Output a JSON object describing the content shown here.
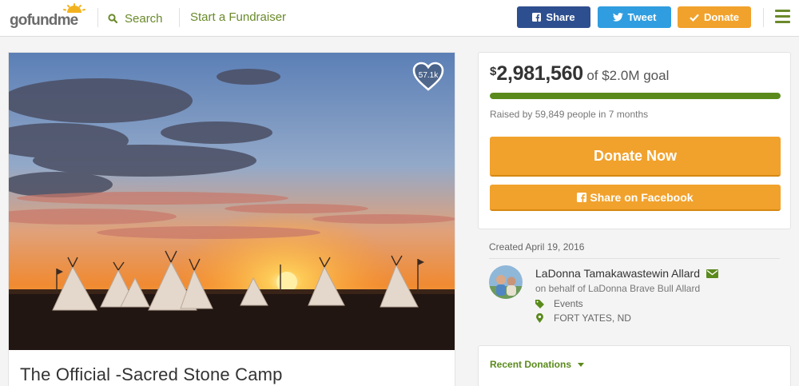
{
  "header": {
    "logo": {
      "text_go": "go",
      "text_fund": "fund",
      "text_me": "me",
      "icon": "sun-logo-icon"
    },
    "search_label": "Search",
    "start_label": "Start a Fundraiser",
    "share_label": "Share",
    "tweet_label": "Tweet",
    "donate_label": "Donate",
    "menu_icon": "hamburger-menu-icon"
  },
  "campaign": {
    "title": "The Official -Sacred Stone Camp",
    "likes": "57.1k"
  },
  "funding": {
    "currency": "$",
    "amount": "2,981,560",
    "goal_text": "of $2.0M goal",
    "progress_fraction": 1.0,
    "raised_by": "Raised by 59,849 people in 7 months",
    "donate_now_label": "Donate Now",
    "share_facebook_label": "Share on Facebook"
  },
  "meta": {
    "created": "Created April 19, 2016",
    "organizer": "LaDonna Tamakawastewin Allard",
    "on_behalf": "on behalf of LaDonna Brave Bull Allard",
    "category": "Events",
    "location": "FORT YATES, ND"
  },
  "recent_donations_label": "Recent Donations",
  "colors": {
    "brand_green": "#5a8a1c",
    "orange": "#f1a22c",
    "facebook": "#2e4f8f",
    "twitter": "#2f9de0"
  }
}
